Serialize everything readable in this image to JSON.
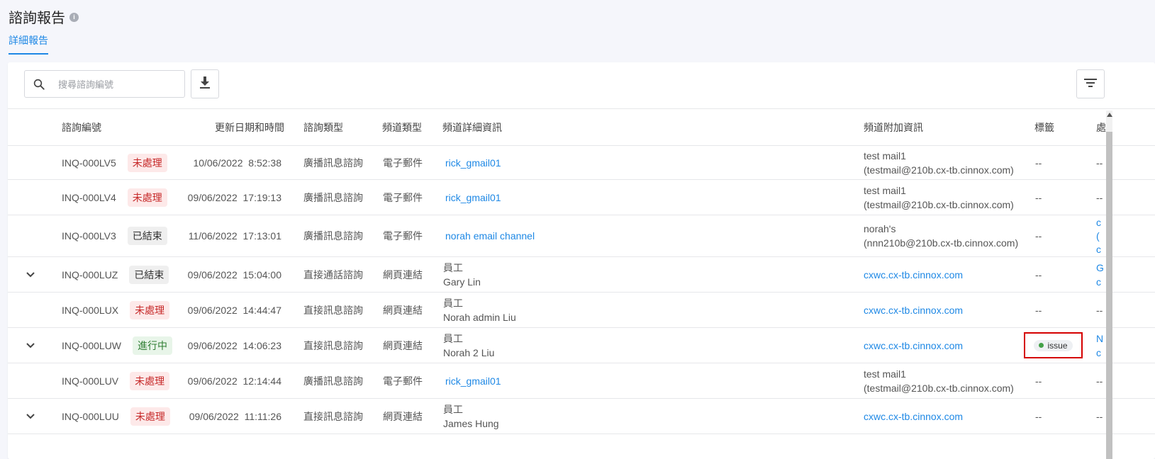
{
  "page": {
    "title": "諮詢報告",
    "info_icon": "info-icon"
  },
  "tabs": [
    {
      "label": "詳細報告",
      "active": true
    }
  ],
  "toolbar": {
    "search_placeholder": "搜尋諮詢編號",
    "download_icon": "download-icon",
    "filter_icon": "filter-icon"
  },
  "table": {
    "columns": [
      "諮詢編號",
      "更新日期和時間",
      "諮詢類型",
      "頻道類型",
      "頻道詳細資訊",
      "頻道附加資訊",
      "標籤",
      "處"
    ],
    "rows": [
      {
        "expandable": false,
        "id": "INQ-000LV5",
        "status": "未處理",
        "status_type": "red",
        "datetime": "10/06/2022  8:52:38",
        "inq_type": "廣播訊息諮詢",
        "channel_type": "電子郵件",
        "detail_link": "rick_gmail01",
        "detail_line1": "",
        "detail_line2": "",
        "extra_line1": "test mail1",
        "extra_line2": "(testmail@210b.cx-tb.cinnox.com)",
        "extra_link": "",
        "tag": "--",
        "handler": [
          "--"
        ],
        "handler_link": false
      },
      {
        "expandable": false,
        "id": "INQ-000LV4",
        "status": "未處理",
        "status_type": "red",
        "datetime": "09/06/2022  17:19:13",
        "inq_type": "廣播訊息諮詢",
        "channel_type": "電子郵件",
        "detail_link": "rick_gmail01",
        "detail_line1": "",
        "detail_line2": "",
        "extra_line1": "test mail1",
        "extra_line2": "(testmail@210b.cx-tb.cinnox.com)",
        "extra_link": "",
        "tag": "--",
        "handler": [
          "--"
        ],
        "handler_link": false
      },
      {
        "expandable": false,
        "id": "INQ-000LV3",
        "status": "已結束",
        "status_type": "grey",
        "datetime": "11/06/2022  17:13:01",
        "inq_type": "廣播訊息諮詢",
        "channel_type": "電子郵件",
        "detail_link": "norah email channel",
        "detail_line1": "",
        "detail_line2": "",
        "extra_line1": "norah's",
        "extra_line2": "(nnn210b@210b.cx-tb.cinnox.com)",
        "extra_link": "",
        "tag": "--",
        "handler": [
          "c",
          "(",
          "c"
        ],
        "handler_link": true
      },
      {
        "expandable": true,
        "id": "INQ-000LUZ",
        "status": "已結束",
        "status_type": "grey",
        "datetime": "09/06/2022  15:04:00",
        "inq_type": "直接通話諮詢",
        "channel_type": "網頁連結",
        "detail_link": "",
        "detail_line1": "員工",
        "detail_line2": "Gary Lin",
        "extra_line1": "",
        "extra_line2": "",
        "extra_link": "cxwc.cx-tb.cinnox.com",
        "tag": "--",
        "handler": [
          "G",
          "c"
        ],
        "handler_link": true
      },
      {
        "expandable": false,
        "id": "INQ-000LUX",
        "status": "未處理",
        "status_type": "red",
        "datetime": "09/06/2022  14:44:47",
        "inq_type": "直接訊息諮詢",
        "channel_type": "網頁連結",
        "detail_link": "",
        "detail_line1": "員工",
        "detail_line2": "Norah admin Liu",
        "extra_line1": "",
        "extra_line2": "",
        "extra_link": "cxwc.cx-tb.cinnox.com",
        "tag": "--",
        "handler": [
          "--"
        ],
        "handler_link": false
      },
      {
        "expandable": true,
        "id": "INQ-000LUW",
        "status": "進行中",
        "status_type": "green",
        "datetime": "09/06/2022  14:06:23",
        "inq_type": "直接訊息諮詢",
        "channel_type": "網頁連結",
        "detail_link": "",
        "detail_line1": "員工",
        "detail_line2": "Norah 2 Liu",
        "extra_line1": "",
        "extra_line2": "",
        "extra_link": "cxwc.cx-tb.cinnox.com",
        "tag": "issue",
        "tag_color": "#43a047",
        "handler": [
          "N",
          "c"
        ],
        "handler_link": true
      },
      {
        "expandable": false,
        "id": "INQ-000LUV",
        "status": "未處理",
        "status_type": "red",
        "datetime": "09/06/2022  12:14:44",
        "inq_type": "廣播訊息諮詢",
        "channel_type": "電子郵件",
        "detail_link": "rick_gmail01",
        "detail_line1": "",
        "detail_line2": "",
        "extra_line1": "test mail1",
        "extra_line2": "(testmail@210b.cx-tb.cinnox.com)",
        "extra_link": "",
        "tag": "--",
        "handler": [
          "--"
        ],
        "handler_link": false
      },
      {
        "expandable": true,
        "id": "INQ-000LUU",
        "status": "未處理",
        "status_type": "red",
        "datetime": "09/06/2022  11:11:26",
        "inq_type": "直接訊息諮詢",
        "channel_type": "網頁連結",
        "detail_link": "",
        "detail_line1": "員工",
        "detail_line2": "James Hung",
        "extra_line1": "",
        "extra_line2": "",
        "extra_link": "cxwc.cx-tb.cinnox.com",
        "tag": "--",
        "handler": [
          "--"
        ],
        "handler_link": false
      }
    ]
  },
  "colors": {
    "accent": "#1e88e5",
    "unprocessed": "#c62828",
    "in_progress": "#2e7d32",
    "highlight": "#d50000"
  }
}
